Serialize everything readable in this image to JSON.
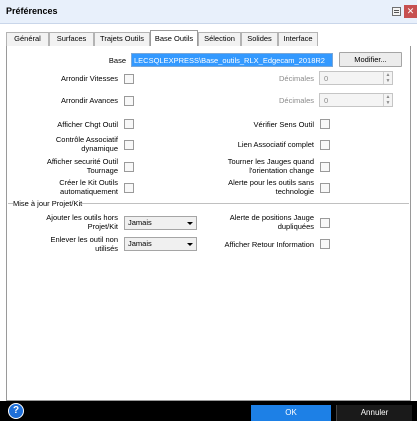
{
  "window": {
    "title": "Préférences"
  },
  "tabs": [
    {
      "label": "Général"
    },
    {
      "label": "Surfaces"
    },
    {
      "label": "Trajets Outils"
    },
    {
      "label": "Base Outils"
    },
    {
      "label": "Sélection"
    },
    {
      "label": "Solides"
    },
    {
      "label": "Interface"
    }
  ],
  "active_tab": "Base Outils",
  "base": {
    "label": "Base",
    "value": "LECSQLEXPRESS\\Base_outils_RLX_Edgecam_2018R2",
    "modify_button": "Modifier..."
  },
  "fields": {
    "arrondir_vitesses": {
      "label": "Arrondir Vitesses",
      "checked": false
    },
    "arrondir_avances": {
      "label": "Arrondir Avances",
      "checked": false
    },
    "decimales_1": {
      "label": "Décimales",
      "value": "0"
    },
    "decimales_2": {
      "label": "Décimales",
      "value": "0"
    },
    "afficher_chgt_outil": {
      "label": "Afficher Chgt Outil",
      "checked": false
    },
    "verifier_sens_outil": {
      "label": "Vérifier Sens Outil",
      "checked": false
    },
    "controle_associatif": {
      "label_line1": "Contrôle Associatif",
      "label_line2": "dynamique",
      "checked": false
    },
    "lien_associatif": {
      "label": "Lien Associatif complet",
      "checked": false
    },
    "afficher_securite": {
      "label_line1": "Afficher securité Outil",
      "label_line2": "Tournage",
      "checked": false
    },
    "tourner_jauges": {
      "label_line1": "Tourner les Jauges quand",
      "label_line2": "l'orientation change",
      "checked": false
    },
    "creer_kit": {
      "label_line1": "Créer le Kit Outils",
      "label_line2": "automatiquement",
      "checked": false
    },
    "alerte_outils": {
      "label_line1": "Alerte pour les outils sans",
      "label_line2": "technologie",
      "checked": false
    }
  },
  "group": {
    "title": "Mise à jour Projet/Kit",
    "ajouter": {
      "label_line1": "Ajouter les outils hors",
      "label_line2": "Projet/Kit",
      "value": "Jamais"
    },
    "enlever": {
      "label_line1": "Enlever les outil non",
      "label_line2": "utilisés",
      "value": "Jamais"
    },
    "alerte_positions": {
      "label_line1": "Alerte de positions Jauge",
      "label_line2": "dupliquées",
      "checked": false
    },
    "afficher_retour": {
      "label": "Afficher Retour Information",
      "checked": false
    }
  },
  "footer": {
    "help_symbol": "?",
    "ok_label": "OK",
    "cancel_label": "Annuler"
  },
  "colors": {
    "accent": "#3399ff",
    "ok": "#1d80e6",
    "footer": "#000000",
    "close": "#c75050"
  }
}
